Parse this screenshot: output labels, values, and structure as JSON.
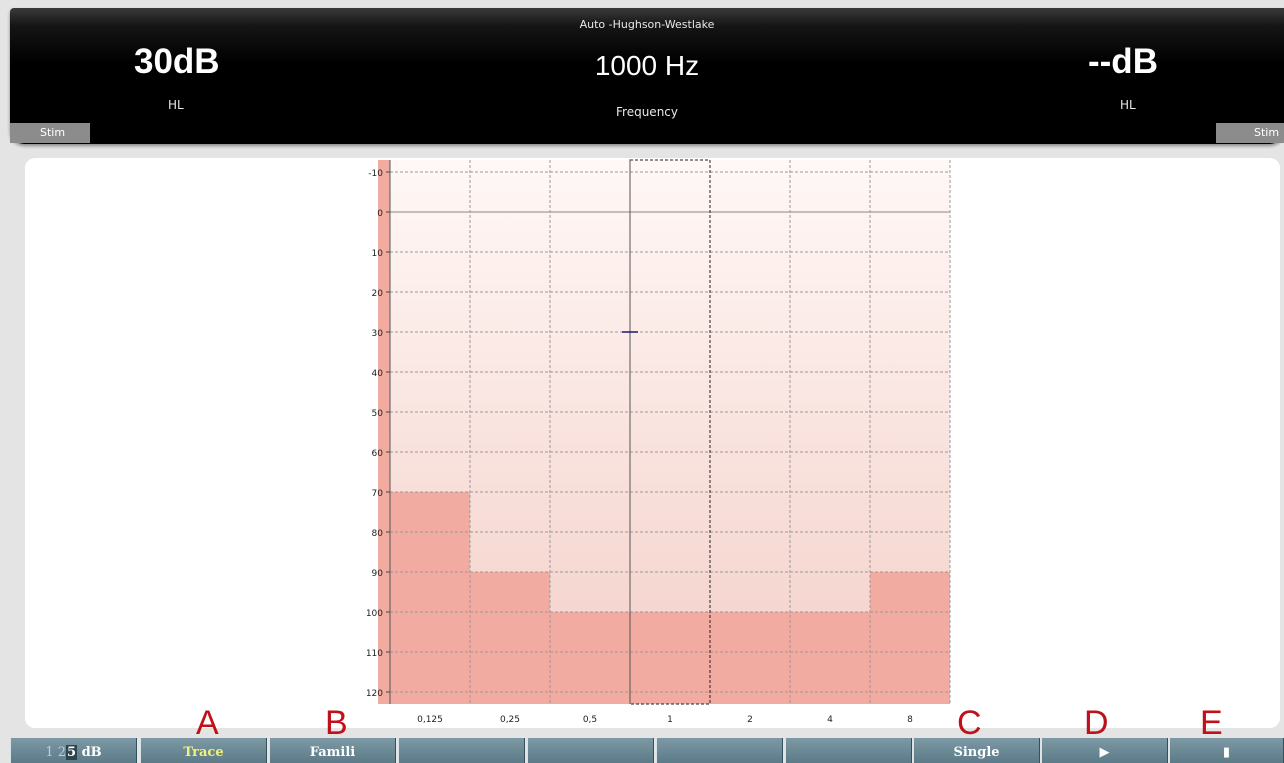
{
  "header": {
    "protocol": "Auto -Hughson-Westlake",
    "left_level": "30dB",
    "left_unit": "HL",
    "frequency": "1000 Hz",
    "frequency_label": "Frequency",
    "right_level": "--dB",
    "right_unit": "HL",
    "stim_left": "Stim",
    "stim_right": "Stim"
  },
  "audiogram": {
    "y_ticks": [
      "-10",
      "0",
      "10",
      "20",
      "30",
      "40",
      "50",
      "60",
      "70",
      "80",
      "90",
      "100",
      "110",
      "120"
    ],
    "x_ticks": [
      "0,125",
      "0,25",
      "0,5",
      "1",
      "2",
      "4",
      "8"
    ],
    "selected_frequency_index": 3,
    "current_level_db": 30,
    "max_output_db": [
      70,
      90,
      100,
      100,
      100,
      100,
      90
    ],
    "colors": {
      "limit_fill": "#f2aba1",
      "background_top": "#fff8f6",
      "background_bottom": "#f4cfc8",
      "marker": "#1a1a6e"
    }
  },
  "toolbar": {
    "step_prefix": "1 2",
    "step_selected": "5",
    "step_suffix": " dB",
    "buttons": [
      "Trace",
      "Famili",
      "",
      "",
      "",
      "",
      "Single",
      "▶",
      "▮"
    ]
  },
  "annotations": [
    "A",
    "B",
    "C",
    "D",
    "E"
  ]
}
